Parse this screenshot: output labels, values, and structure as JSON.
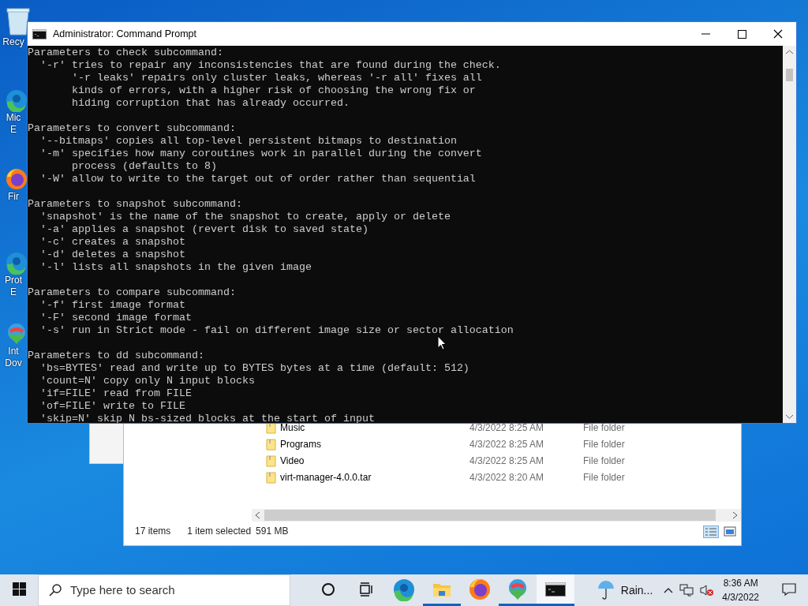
{
  "desktop_icons": [
    {
      "kind": "recycle",
      "lines": [
        "Recy"
      ]
    },
    {
      "kind": "edge",
      "lines": [
        "Mic",
        "E"
      ]
    },
    {
      "kind": "firefox",
      "lines": [
        "Fir"
      ]
    },
    {
      "kind": "edge",
      "lines": [
        "Prot",
        "E"
      ]
    },
    {
      "kind": "idm",
      "lines": [
        "Int",
        "Dov"
      ]
    }
  ],
  "explorer": {
    "rows": [
      {
        "name": "Music",
        "date": "4/3/2022 8:25 AM",
        "type": "File folder"
      },
      {
        "name": "Programs",
        "date": "4/3/2022 8:25 AM",
        "type": "File folder"
      },
      {
        "name": "Video",
        "date": "4/3/2022 8:25 AM",
        "type": "File folder"
      },
      {
        "name": "virt-manager-4.0.0.tar",
        "date": "4/3/2022 8:20 AM",
        "type": "File folder"
      }
    ],
    "status": {
      "count": "17 items",
      "selection": "1 item selected",
      "size": "591 MB"
    }
  },
  "console": {
    "title": "Administrator: Command Prompt",
    "sections": [
      {
        "lines": [
          "Parameters to check subcommand:",
          "  '-r' tries to repair any inconsistencies that are found during the check.",
          "       '-r leaks' repairs only cluster leaks, whereas '-r all' fixes all",
          "       kinds of errors, with a higher risk of choosing the wrong fix or",
          "       hiding corruption that has already occurred."
        ]
      },
      {
        "lines": [
          "Parameters to convert subcommand:",
          "  '--bitmaps' copies all top-level persistent bitmaps to destination",
          "  '-m' specifies how many coroutines work in parallel during the convert",
          "       process (defaults to 8)",
          "  '-W' allow to write to the target out of order rather than sequential"
        ]
      },
      {
        "lines": [
          "Parameters to snapshot subcommand:",
          "  'snapshot' is the name of the snapshot to create, apply or delete",
          "  '-a' applies a snapshot (revert disk to saved state)",
          "  '-c' creates a snapshot",
          "  '-d' deletes a snapshot",
          "  '-l' lists all snapshots in the given image"
        ]
      },
      {
        "lines": [
          "Parameters to compare subcommand:",
          "  '-f' first image format",
          "  '-F' second image format",
          "  '-s' run in Strict mode - fail on different image size or sector allocation"
        ]
      },
      {
        "lines": [
          "Parameters to dd subcommand:",
          "  'bs=BYTES' read and write up to BYTES bytes at a time (default: 512)",
          "  'count=N' copy only N input blocks",
          "  'if=FILE' read from FILE",
          "  'of=FILE' write to FILE",
          "  'skip=N' skip N bs-sized blocks at the start of input"
        ]
      }
    ]
  },
  "taskbar": {
    "search": {
      "placeholder": "Type here to search"
    },
    "apps": [
      {
        "kind": "cortana",
        "running": false,
        "selected": false
      },
      {
        "kind": "taskview",
        "running": false,
        "selected": false
      },
      {
        "kind": "edge",
        "running": false,
        "selected": false
      },
      {
        "kind": "explorer",
        "running": true,
        "selected": false
      },
      {
        "kind": "firefox",
        "running": false,
        "selected": false
      },
      {
        "kind": "idm",
        "running": true,
        "selected": false
      },
      {
        "kind": "cmd",
        "running": true,
        "selected": true
      }
    ],
    "weather": "Rain...",
    "clock": {
      "time": "8:36 AM",
      "date": "4/3/2022"
    }
  }
}
